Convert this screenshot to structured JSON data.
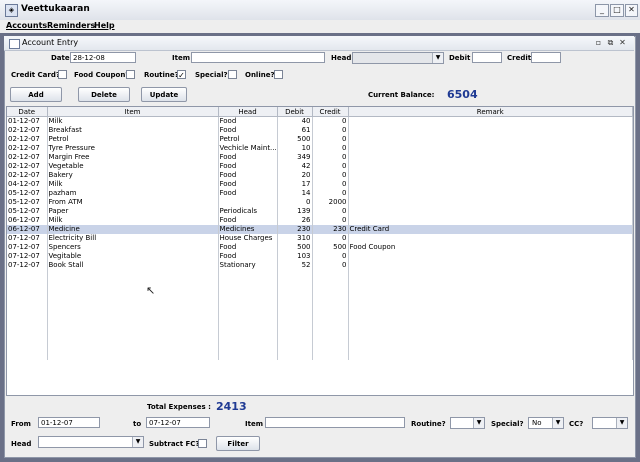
{
  "window": {
    "title": "Veettukaaran"
  },
  "menu": [
    "Accounts",
    "Reminders",
    "Help"
  ],
  "frame": {
    "title": "Account Entry"
  },
  "entry": {
    "date_label": "Date",
    "date_value": "28-12-08",
    "item_label": "Item",
    "item_value": "",
    "head_label": "Head",
    "head_value": "",
    "debit_label": "Debit",
    "debit_value": "",
    "credit_label": "Credit",
    "credit_value": ""
  },
  "flags": [
    {
      "label": "Credit Card?",
      "checked": false
    },
    {
      "label": "Food Coupon?",
      "checked": false
    },
    {
      "label": "Routine?",
      "checked": true
    },
    {
      "label": "Special?",
      "checked": false
    },
    {
      "label": "Online?",
      "checked": false
    }
  ],
  "buttons": {
    "add": "Add",
    "delete": "Delete",
    "update": "Update"
  },
  "balance": {
    "label": "Current Balance:",
    "value": "6504"
  },
  "table": {
    "columns": [
      "Date",
      "Item",
      "Head",
      "Debit",
      "Credit",
      "Remark"
    ],
    "rows": [
      [
        "01-12-07",
        "Milk",
        "Food",
        "40",
        "0",
        ""
      ],
      [
        "02-12-07",
        "Breakfast",
        "Food",
        "61",
        "0",
        ""
      ],
      [
        "02-12-07",
        "Petrol",
        "Petrol",
        "500",
        "0",
        ""
      ],
      [
        "02-12-07",
        "Tyre Pressure",
        "Vechicle Maint...",
        "10",
        "0",
        ""
      ],
      [
        "02-12-07",
        "Margin Free",
        "Food",
        "349",
        "0",
        ""
      ],
      [
        "02-12-07",
        "Vegetable",
        "Food",
        "42",
        "0",
        ""
      ],
      [
        "02-12-07",
        "Bakery",
        "Food",
        "20",
        "0",
        ""
      ],
      [
        "04-12-07",
        "Milk",
        "Food",
        "17",
        "0",
        ""
      ],
      [
        "05-12-07",
        "pazham",
        "Food",
        "14",
        "0",
        ""
      ],
      [
        "05-12-07",
        "From ATM",
        "",
        "0",
        "2000",
        ""
      ],
      [
        "05-12-07",
        "Paper",
        "Periodicals",
        "139",
        "0",
        ""
      ],
      [
        "06-12-07",
        "Milk",
        "Food",
        "26",
        "0",
        ""
      ],
      [
        "06-12-07",
        "Medicine",
        "Medicines",
        "230",
        "230",
        "Credit Card"
      ],
      [
        "07-12-07",
        "Electricity Bill",
        "House Charges",
        "310",
        "0",
        ""
      ],
      [
        "07-12-07",
        "Spencers",
        "Food",
        "500",
        "500",
        "Food Coupon"
      ],
      [
        "07-12-07",
        "Vegitable",
        "Food",
        "103",
        "0",
        ""
      ],
      [
        "07-12-07",
        "Book Stall",
        "Stationary",
        "52",
        "0",
        ""
      ]
    ],
    "selected_row": 12
  },
  "totals": {
    "label": "Total Expenses :",
    "value": "2413"
  },
  "filter": {
    "from_label": "From",
    "from_value": "01-12-07",
    "to_label": "to",
    "to_value": "07-12-07",
    "item_label": "Item",
    "item_value": "",
    "routine_label": "Routine?",
    "routine_value": "",
    "special_label": "Special?",
    "special_value": "No",
    "cc_label": "CC?",
    "cc_value": "",
    "head_label": "Head",
    "head_value": "",
    "subtract_label": "Subtract FC?",
    "subtract_checked": false,
    "button": "Filter"
  },
  "colors": {
    "accent": "#1f3a93",
    "selection": "#c9d3e8",
    "desktop": "#6a7087"
  }
}
